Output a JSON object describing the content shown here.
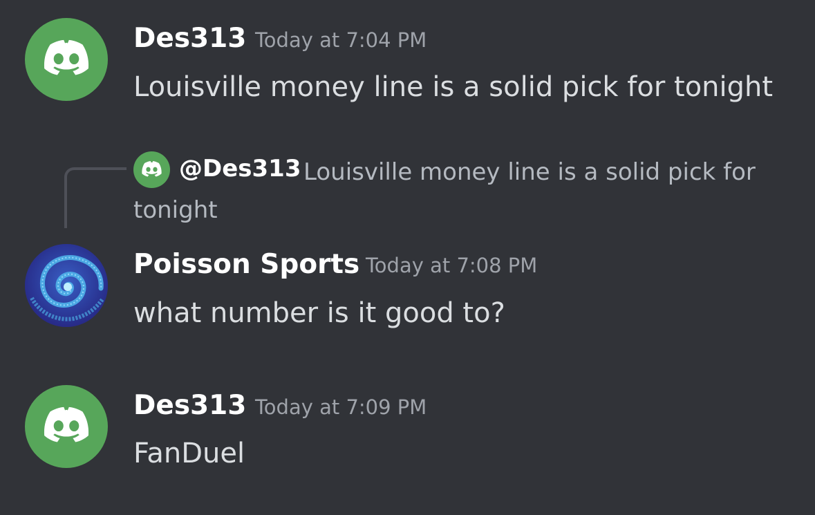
{
  "messages": [
    {
      "author": "Des313",
      "timestamp": "Today at 7:04 PM",
      "content": "Louisville money line is a solid pick for tonight",
      "avatar": "discord-logo-icon",
      "avatar_color": "#57a65a"
    },
    {
      "author": "Poisson Sports",
      "timestamp": "Today at 7:08 PM",
      "content": "what number is it good to?",
      "avatar": "spiral-galaxy-icon",
      "reply": {
        "author": "@Des313",
        "text": "Louisville money line is a solid pick for tonight",
        "avatar": "discord-logo-icon"
      }
    },
    {
      "author": "Des313",
      "timestamp": "Today at 7:09 PM",
      "content": "FanDuel",
      "avatar": "discord-logo-icon",
      "avatar_color": "#57a65a"
    }
  ],
  "colors": {
    "background": "#313338",
    "username": "#ffffff",
    "message_text": "#dbdee1",
    "timestamp": "#9fa3aa",
    "reply_text": "#b5bac1",
    "discord_green": "#57a65a"
  }
}
